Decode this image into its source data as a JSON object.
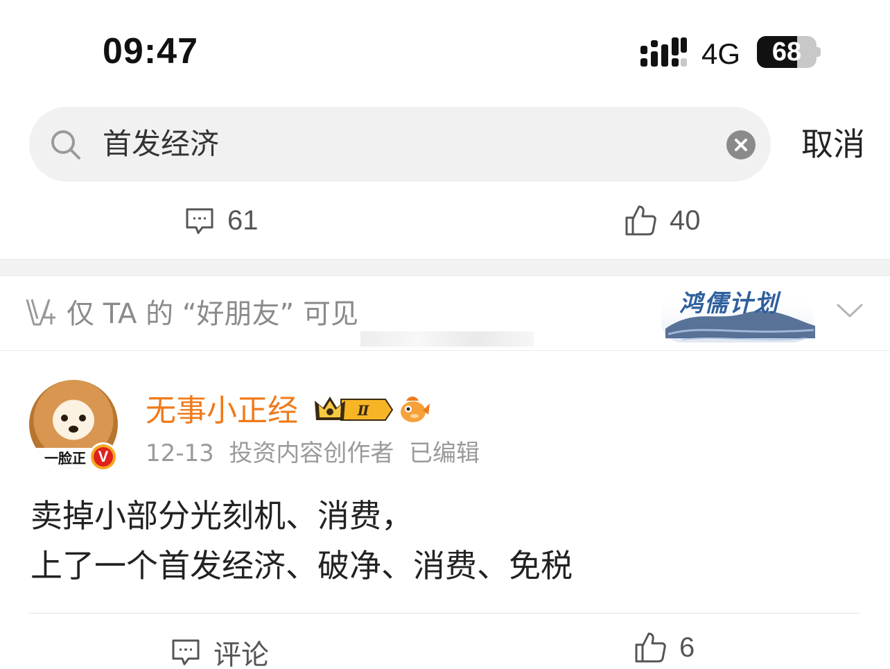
{
  "status_bar": {
    "time": "09:47",
    "network": "4G",
    "battery_level": "68",
    "battery_fraction": 0.68
  },
  "search": {
    "query": "首发经济",
    "cancel_label": "取消"
  },
  "previous_post_actions": {
    "comments_count": "61",
    "likes_count": "40"
  },
  "visibility": {
    "notice": "仅 TA 的 “好朋友” 可见",
    "campaign": "鸿儒计划"
  },
  "post": {
    "author": "无事小正经",
    "avatar_caption": "一脸正",
    "verified_mark": "V",
    "crown_level": "Ⅱ",
    "date": "12-13",
    "author_title": "投资内容创作者",
    "edited_label": "已编辑",
    "body_lines": [
      "卖掉小部分光刻机、消费，",
      "上了一个首发经济、破净、消费、免税"
    ],
    "comment_label": "评论",
    "likes_count": "6"
  },
  "colors": {
    "username": "#f07a1a",
    "muted": "#9a9a9a",
    "campaign": "#2f5f9e",
    "verified": "#e0201a"
  },
  "icons": [
    "signal-icon",
    "search-icon",
    "clear-icon",
    "comment-icon",
    "like-icon",
    "visibility-v-icon",
    "chevron-down-icon",
    "crown-badge-icon",
    "fish-badge-icon"
  ]
}
